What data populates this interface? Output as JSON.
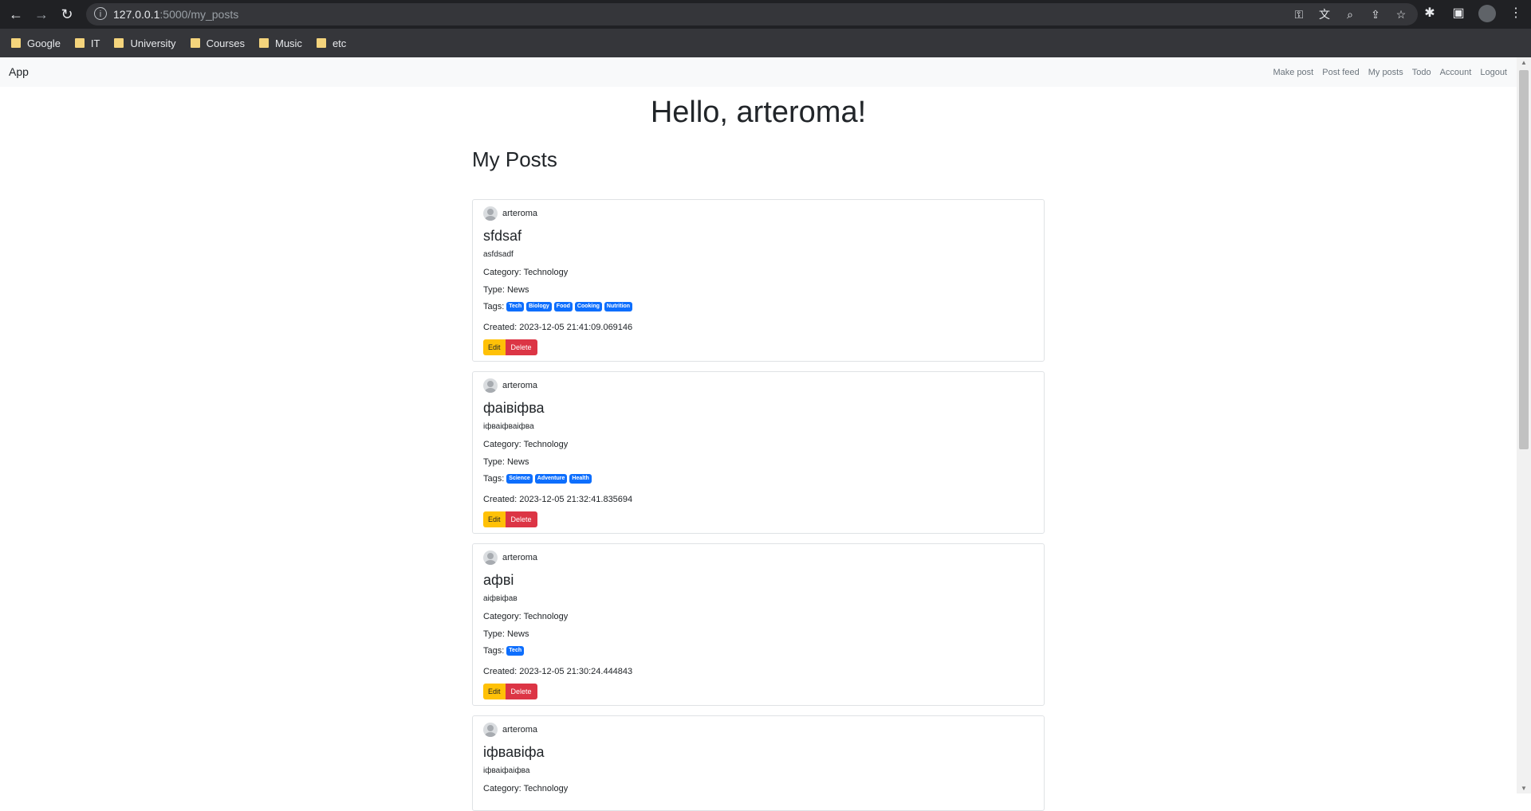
{
  "browser": {
    "url_host": "127.0.0.1",
    "url_rest": ":5000/my_posts",
    "bookmarks": [
      "Google",
      "IT",
      "University",
      "Courses",
      "Music",
      "etc"
    ]
  },
  "navbar": {
    "brand": "App",
    "links": [
      "Make post",
      "Post feed",
      "My posts",
      "Todo",
      "Account",
      "Logout"
    ]
  },
  "greeting": "Hello, arteroma!",
  "section_title": "My Posts",
  "labels": {
    "category": "Category: ",
    "type": "Type: ",
    "tags": "Tags:",
    "created": "Created: ",
    "edit": "Edit",
    "delete": "Delete"
  },
  "posts": [
    {
      "author": "arteroma",
      "title": "sfdsaf",
      "description": "asfdsadf",
      "category": "Technology",
      "type": "News",
      "tags": [
        "Tech",
        "Biology",
        "Food",
        "Cooking",
        "Nutrition"
      ],
      "created": "2023-12-05 21:41:09.069146"
    },
    {
      "author": "arteroma",
      "title": "фаівіфва",
      "description": "іфваіфваіфва",
      "category": "Technology",
      "type": "News",
      "tags": [
        "Science",
        "Adventure",
        "Health"
      ],
      "created": "2023-12-05 21:32:41.835694"
    },
    {
      "author": "arteroma",
      "title": "афві",
      "description": "аіфвіфав",
      "category": "Technology",
      "type": "News",
      "tags": [
        "Tech"
      ],
      "created": "2023-12-05 21:30:24.444843"
    },
    {
      "author": "arteroma",
      "title": "іфвавіфа",
      "description": "іфваіфаіфва",
      "category": "Technology",
      "type": "",
      "tags": [],
      "created": ""
    }
  ]
}
